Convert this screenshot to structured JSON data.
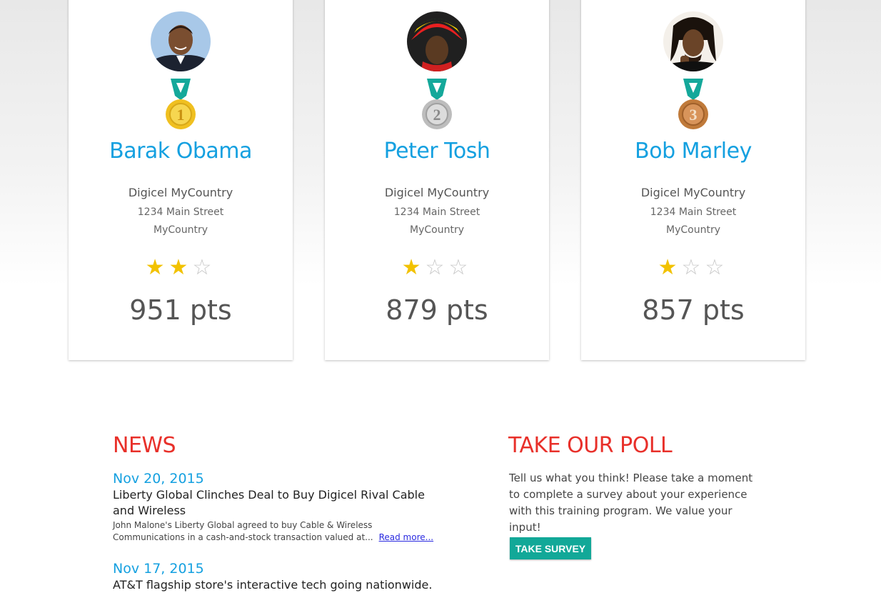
{
  "leaderboard": [
    {
      "rank": "1",
      "medal": "gold-medal",
      "name": "Barak Obama",
      "company": "Digicel MyCountry",
      "street": "1234 Main Street",
      "country": "MyCountry",
      "rating": 2,
      "rating_max": 3,
      "points": "951 pts"
    },
    {
      "rank": "2",
      "medal": "silver-medal",
      "name": "Peter Tosh",
      "company": "Digicel MyCountry",
      "street": "1234 Main Street",
      "country": "MyCountry",
      "rating": 1,
      "rating_max": 3,
      "points": "879 pts"
    },
    {
      "rank": "3",
      "medal": "bronze-medal",
      "name": "Bob Marley",
      "company": "Digicel MyCountry",
      "street": "1234 Main Street",
      "country": "MyCountry",
      "rating": 1,
      "rating_max": 3,
      "points": "857 pts"
    }
  ],
  "news": {
    "title": "NEWS",
    "items": [
      {
        "date": "Nov 20, 2015",
        "headline": "Liberty Global Clinches Deal to Buy Digicel Rival Cable and Wireless",
        "excerpt": "John Malone's Liberty Global agreed to buy Cable & Wireless Communications in a cash-and-stock transaction valued at...",
        "read_more": "Read more..."
      },
      {
        "date": "Nov 17, 2015",
        "headline": "AT&T flagship store's interactive tech going nationwide."
      }
    ]
  },
  "poll": {
    "title": "TAKE OUR POLL",
    "text": "Tell us what you think! Please take a moment to complete a survey about your experience with this training program. We value your input!",
    "button_label": "TAKE SURVEY"
  },
  "colors": {
    "accent_blue": "#14a0e0",
    "heading_red": "#e8302a",
    "button_teal": "#12a898",
    "star_gold": "#f2c200",
    "ribbon_teal": "#14a89a",
    "gold": "#f0c020",
    "silver": "#c0c0c0",
    "bronze": "#c07a3a"
  }
}
